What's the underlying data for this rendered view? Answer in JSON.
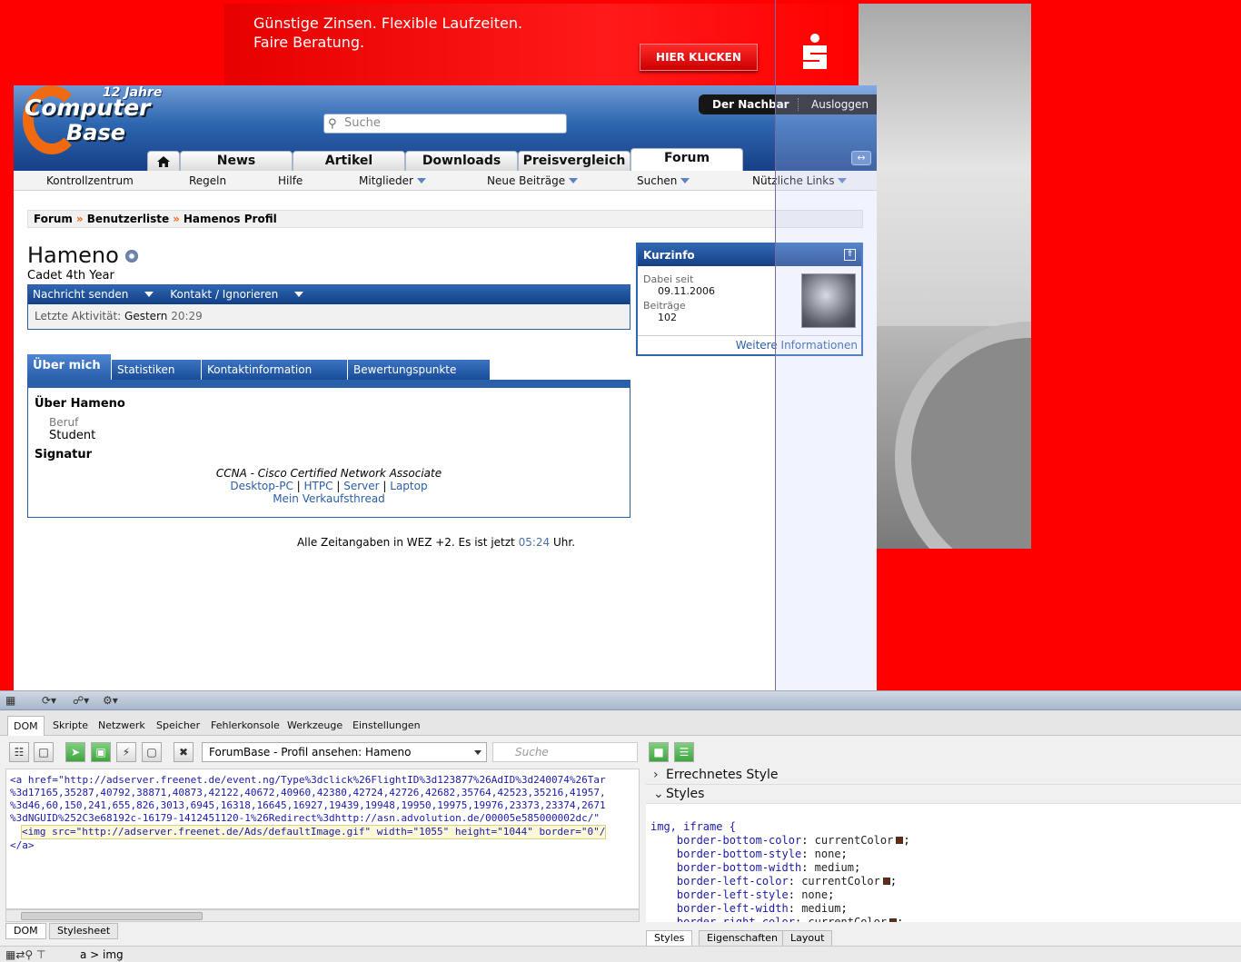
{
  "ad": {
    "line1": "Günstige Zinsen. Flexible Laufzeiten.",
    "line2": "Faire Beratung.",
    "button": "HIER KLICKEN",
    "brand_icon": "sparkasse-logo",
    "brand_color": "#ff0000"
  },
  "site": {
    "logo_years": "12 Jahre",
    "logo_word1": "Computer",
    "logo_word2": "Base",
    "search_placeholder": "Suche",
    "user_name": "Der Nachbar",
    "logout": "Ausloggen",
    "main_tabs": [
      "News",
      "Artikel",
      "Downloads",
      "Preisvergleich",
      "Forum"
    ],
    "active_tab": "Forum",
    "subnav": [
      {
        "label": "Kontrollzentrum"
      },
      {
        "label": "Regeln"
      },
      {
        "label": "Hilfe"
      },
      {
        "label": "Mitglieder"
      },
      {
        "label": "Neue Beiträge"
      },
      {
        "label": "Suchen"
      },
      {
        "label": "Nützliche Links"
      }
    ],
    "breadcrumb": [
      "Forum",
      "Benutzerliste",
      "Hamenos Profil"
    ],
    "breadcrumb_sep": "»"
  },
  "profile": {
    "name": "Hameno",
    "rank": "Cadet 4th Year",
    "actions": [
      "Nachricht senden",
      "Kontakt / Ignorieren"
    ],
    "last_activity_label": "Letzte Aktivität:",
    "last_activity_day": "Gestern",
    "last_activity_time": "20:29",
    "tabs": [
      "Über mich",
      "Statistiken",
      "Kontaktinformation",
      "Bewertungspunkte"
    ],
    "about_title": "Über Hameno",
    "beruf_label": "Beruf",
    "beruf_value": "Student",
    "signature_title": "Signatur",
    "sig_ccna": "CCNA - Cisco Certified Network Associate",
    "sig_links": [
      "Desktop-PC",
      "HTPC",
      "Server",
      "Laptop"
    ],
    "sig_sep": "|",
    "sig_thread": "Mein Verkaufsthread"
  },
  "kurzinfo": {
    "title": "Kurzinfo",
    "joined_label": "Dabei seit",
    "joined_value": "09.11.2006",
    "posts_label": "Beiträge",
    "posts_value": "102",
    "more": "Weitere Informationen"
  },
  "footer": {
    "text_before": "Alle Zeitangaben in WEZ +2. Es ist jetzt",
    "time": "05:24",
    "text_after": "Uhr."
  },
  "devtools": {
    "tabs": [
      "DOM",
      "Skripte",
      "Netzwerk",
      "Speicher",
      "Fehlerkonsole",
      "Werkzeuge",
      "Einstellungen"
    ],
    "active_tab": "DOM",
    "document_select": "ForumBase - Profil ansehen: Hameno",
    "search_placeholder": "Suche",
    "dom_lines": [
      "<a href=\"http://adserver.freenet.de/event.ng/Type%3dclick%26FlightID%3d123877%26AdID%3d240074%26Tar",
      "%3d17165,35287,40792,38871,40873,42122,40672,40960,42380,42724,42726,42682,35764,42523,35216,41957,",
      "%3d46,60,150,241,655,826,3013,6945,16318,16645,16927,19439,19948,19950,19975,19976,23373,23374,2671",
      "%3dNGUID%252C3e68192c-16179-1412451120-1%26Redirect%3dhttp://asn.advolution.de/00005e585000002dc/\"",
      "<img src=\"http://adserver.freenet.de/Ads/defaultImage.gif\" width=\"1055\" height=\"1044\" border=\"0\"/",
      "</a>"
    ],
    "dom_bottom_tabs": [
      "DOM",
      "Stylesheet"
    ],
    "computed_style": "Errechnetes Style",
    "styles": "Styles",
    "css_selector": "img, iframe {",
    "css_rules": [
      {
        "prop": "border-bottom-color",
        "val": "currentColor",
        "swatch": true
      },
      {
        "prop": "border-bottom-style",
        "val": "none",
        "swatch": false
      },
      {
        "prop": "border-bottom-width",
        "val": "medium",
        "swatch": false
      },
      {
        "prop": "border-left-color",
        "val": "currentColor",
        "swatch": true
      },
      {
        "prop": "border-left-style",
        "val": "none",
        "swatch": false
      },
      {
        "prop": "border-left-width",
        "val": "medium",
        "swatch": false
      },
      {
        "prop": "border-right-color",
        "val": "currentColor",
        "swatch": true
      }
    ],
    "style_bottom_tabs": [
      "Styles",
      "Eigenschaften",
      "Layout"
    ],
    "status_path": "a > img"
  }
}
